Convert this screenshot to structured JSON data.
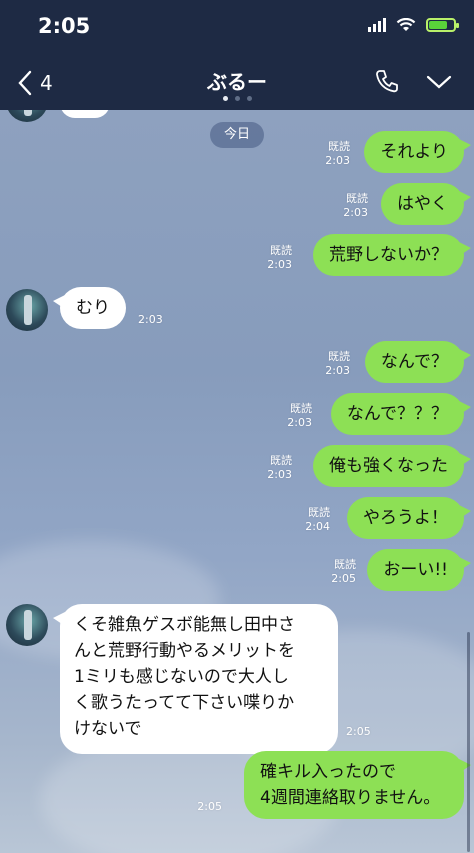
{
  "status_bar": {
    "time": "2:05"
  },
  "header": {
    "back_count": "4",
    "title": "ぶるー",
    "page_dots": 3,
    "active_dot": 1
  },
  "chat": {
    "date_label": "今日",
    "read_label": "既読",
    "messages": [
      {
        "dir": "out",
        "text": "それより",
        "time": "2:03",
        "read": true
      },
      {
        "dir": "out",
        "text": "はやく",
        "time": "2:03",
        "read": true
      },
      {
        "dir": "out",
        "text": "荒野しないか？",
        "time": "2:03",
        "read": true
      },
      {
        "dir": "in",
        "text": "むり",
        "time": "2:03"
      },
      {
        "dir": "out",
        "text": "なんで？",
        "time": "2:03",
        "read": true
      },
      {
        "dir": "out",
        "text": "なんで？？？",
        "time": "2:03",
        "read": true
      },
      {
        "dir": "out",
        "text": "俺も強くなった",
        "time": "2:03",
        "read": true
      },
      {
        "dir": "out",
        "text": "やろうよ！",
        "time": "2:04",
        "read": true
      },
      {
        "dir": "out",
        "text": "おーい!!",
        "time": "2:05",
        "read": true
      },
      {
        "dir": "in",
        "lines": [
          "くそ雑魚ゲスボ能無し田中さ",
          "んと荒野行動やるメリットを",
          "1ミリも感じないので大人し",
          "く歌うたってて下さい喋りか",
          "けないで"
        ],
        "time": "2:05"
      },
      {
        "dir": "out",
        "lines": [
          "確キル入ったので",
          "4週間連絡取りません。"
        ],
        "time": "2:05",
        "read": false
      }
    ]
  },
  "colors": {
    "header_bg": "#1e2a44",
    "outgoing_bubble": "#8de055",
    "incoming_bubble": "#ffffff"
  }
}
